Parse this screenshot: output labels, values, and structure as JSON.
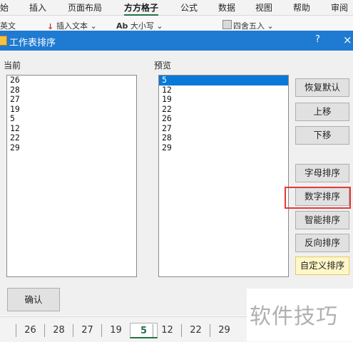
{
  "ribbon": {
    "tabs": [
      {
        "label": "始"
      },
      {
        "label": "插入"
      },
      {
        "label": "页面布局"
      },
      {
        "label": "方方格子"
      },
      {
        "label": "公式"
      },
      {
        "label": "数据"
      },
      {
        "label": "视图"
      },
      {
        "label": "帮助"
      },
      {
        "label": "审阅"
      }
    ],
    "active_tab": "方方格子",
    "tools": {
      "english": "英文",
      "insert_text": "插入文本",
      "case": "大小写",
      "round": "四舍五入"
    }
  },
  "dialog": {
    "title": "工作表排序",
    "help": "?",
    "close": "×",
    "current_label": "当前",
    "current_items": [
      "26",
      "28",
      "27",
      "19",
      "5",
      "12",
      "22",
      "29"
    ],
    "preview_label": "预览",
    "preview_items": [
      "5",
      "12",
      "19",
      "22",
      "26",
      "27",
      "28",
      "29"
    ],
    "preview_selected": "5",
    "buttons": {
      "restore": "恢复默认",
      "move_up": "上移",
      "move_down": "下移",
      "alpha_sort": "字母排序",
      "numeric_sort": "数字排序",
      "smart_sort": "智能排序",
      "reverse_sort": "反向排序",
      "custom_sort": "自定义排序"
    },
    "confirm": "确认"
  },
  "sheet_tabs": [
    "26",
    "28",
    "27",
    "19",
    "5",
    "12",
    "22",
    "29"
  ],
  "active_sheet": "5",
  "watermark": "软件技巧",
  "colors": {
    "titlebar": "#1f7bd1",
    "selection": "#0a78d7",
    "highlight_box": "#e53935",
    "accent": "#217346"
  }
}
